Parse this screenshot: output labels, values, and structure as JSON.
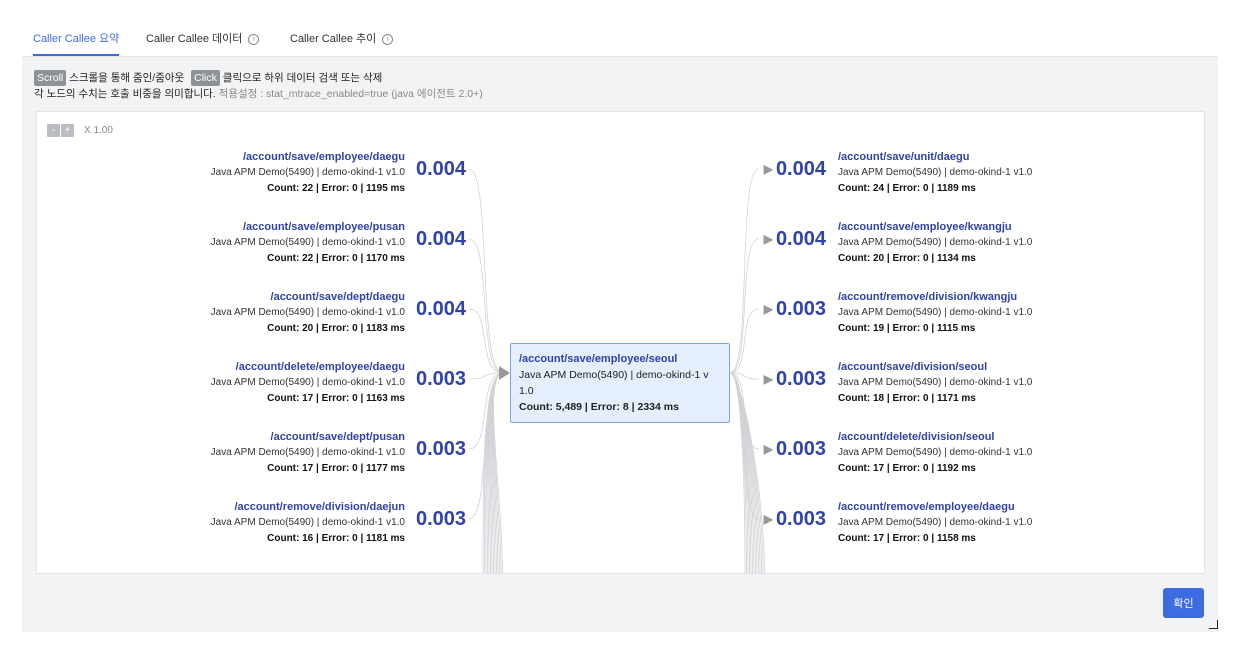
{
  "tabs": [
    {
      "label": "Caller Callee 요약",
      "active": true,
      "info": false
    },
    {
      "label": "Caller Callee 데이터",
      "active": false,
      "info": true
    },
    {
      "label": "Caller Callee 추이",
      "active": false,
      "info": true
    }
  ],
  "help": {
    "scroll_key": "Scroll",
    "scroll_text": "스크롤을 통해 줌인/줌아웃",
    "click_key": "Click",
    "click_text": "클릭으로 하위 데이터 검색 또는 삭제",
    "line2_main": "각 노드의 수치는 호출 비중을 의미합니다.",
    "line2_sub": "적용설정 : stat_mtrace_enabled=true (java 에이전트 2.0+)"
  },
  "zoom": {
    "minus": "-",
    "plus": "+",
    "value": "X 1.00"
  },
  "center": {
    "name": "/account/save/employee/seoul",
    "detail": "Java APM Demo(5490) | demo-okind-1 v 1.0",
    "stats": "Count: 5,489 | Error: 8 | 2334 ms"
  },
  "callers": [
    {
      "name": "/account/save/employee/daegu",
      "detail": "Java APM Demo(5490) | demo-okind-1 v1.0",
      "stats": "Count: 22 | Error: 0 | 1195 ms",
      "ratio": "0.004"
    },
    {
      "name": "/account/save/employee/pusan",
      "detail": "Java APM Demo(5490) | demo-okind-1 v1.0",
      "stats": "Count: 22 | Error: 0 | 1170 ms",
      "ratio": "0.004"
    },
    {
      "name": "/account/save/dept/daegu",
      "detail": "Java APM Demo(5490) | demo-okind-1 v1.0",
      "stats": "Count: 20 | Error: 0 | 1183 ms",
      "ratio": "0.004"
    },
    {
      "name": "/account/delete/employee/daegu",
      "detail": "Java APM Demo(5490) | demo-okind-1 v1.0",
      "stats": "Count: 17 | Error: 0 | 1163 ms",
      "ratio": "0.003"
    },
    {
      "name": "/account/save/dept/pusan",
      "detail": "Java APM Demo(5490) | demo-okind-1 v1.0",
      "stats": "Count: 17 | Error: 0 | 1177 ms",
      "ratio": "0.003"
    },
    {
      "name": "/account/remove/division/daejun",
      "detail": "Java APM Demo(5490) | demo-okind-1 v1.0",
      "stats": "Count: 16 | Error: 0 | 1181 ms",
      "ratio": "0.003"
    }
  ],
  "callees": [
    {
      "name": "/account/save/unit/daegu",
      "detail": "Java APM Demo(5490) | demo-okind-1 v1.0",
      "stats": "Count: 24 | Error: 0 | 1189 ms",
      "ratio": "0.004"
    },
    {
      "name": "/account/save/employee/kwangju",
      "detail": "Java APM Demo(5490) | demo-okind-1 v1.0",
      "stats": "Count: 20 | Error: 0 | 1134 ms",
      "ratio": "0.004"
    },
    {
      "name": "/account/remove/division/kwangju",
      "detail": "Java APM Demo(5490) | demo-okind-1 v1.0",
      "stats": "Count: 19 | Error: 0 | 1115 ms",
      "ratio": "0.003"
    },
    {
      "name": "/account/save/division/seoul",
      "detail": "Java APM Demo(5490) | demo-okind-1 v1.0",
      "stats": "Count: 18 | Error: 0 | 1171 ms",
      "ratio": "0.003"
    },
    {
      "name": "/account/delete/division/seoul",
      "detail": "Java APM Demo(5490) | demo-okind-1 v1.0",
      "stats": "Count: 17 | Error: 0 | 1192 ms",
      "ratio": "0.003"
    },
    {
      "name": "/account/remove/employee/daegu",
      "detail": "Java APM Demo(5490) | demo-okind-1 v1.0",
      "stats": "Count: 17 | Error: 0 | 1158 ms",
      "ratio": "0.003"
    }
  ],
  "confirm_label": "확인",
  "colors": {
    "accent": "#3d6be0",
    "node_title": "#2f43a8",
    "center_bg": "#e4eefc"
  }
}
